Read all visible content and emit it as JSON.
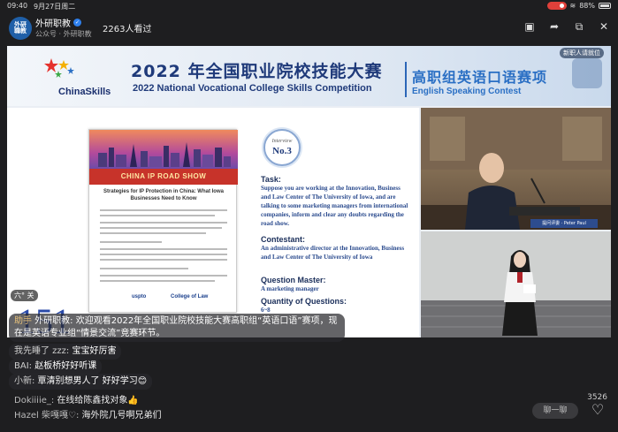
{
  "status": {
    "time": "09:40",
    "date": "9月27日周二",
    "battery": "88%"
  },
  "header": {
    "avatar_text": "外研\n職教",
    "account_name": "外研职教",
    "account_sub": "公众号 · 外研职教",
    "viewers": "2263人看过"
  },
  "video": {
    "brand": "ChinaSkills",
    "title_cn": "2022 年全国职业院校技能大赛",
    "title_en": "2022 National Vocational College Skills Competition",
    "contest_cn": "高职组英语口语赛项",
    "contest_en": "English Speaking Contest",
    "newcomer_tip": "新职人请就位",
    "poster_band": "CHINA IP ROAD SHOW",
    "poster_sub": "Strategies for IP Protection in China: What Iowa Businesses Need to Know",
    "poster_logo1": "uspto",
    "poster_logo2": "College of Law",
    "number": "151",
    "badge_label": "Interview",
    "badge_no": "No.3",
    "task_h": "Task:",
    "task_p": "Suppose you are working at the Innovation, Business and Law Center of The University of Iowa, and are talking to some marketing managers from international companies, inform and clear any doubts regarding the road show.",
    "contestant_h": "Contestant:",
    "contestant_p": "An administrative director at the Innovation, Business and Law Center of The University of Iowa",
    "master_h": "Question Master:",
    "master_p": "A marketing manager",
    "quantity_h": "Quantity of Questions:",
    "quantity_p": "6~8",
    "nameplate": "提问评委 · Peter Paul",
    "overlay_tag": "六° 关"
  },
  "chat": [
    {
      "user": "助手",
      "text": " 外研职教: 欢迎观看2022年全国职业院校技能大赛高职组“英语口语”赛项，现在是英语专业组“情景交流”竞赛环节。"
    },
    {
      "user": "我先睡了 zzz:",
      "text": " 宝宝好厉害"
    },
    {
      "user": "BAI:",
      "text": " 赵板桥好好听课"
    },
    {
      "user": "小新:",
      "text": " 覃清别想男人了 好好学习😊"
    }
  ],
  "bottom": {
    "msg1_user": "Dokiiiie_:",
    "msg1_text": "在线给陈鑫找对象👍",
    "msg2_user": "Hazel 柴嘎嘎♡:",
    "msg2_text": "海外院几号啊兄弟们",
    "likes": "3526",
    "chat_placeholder": "聊一聊"
  }
}
